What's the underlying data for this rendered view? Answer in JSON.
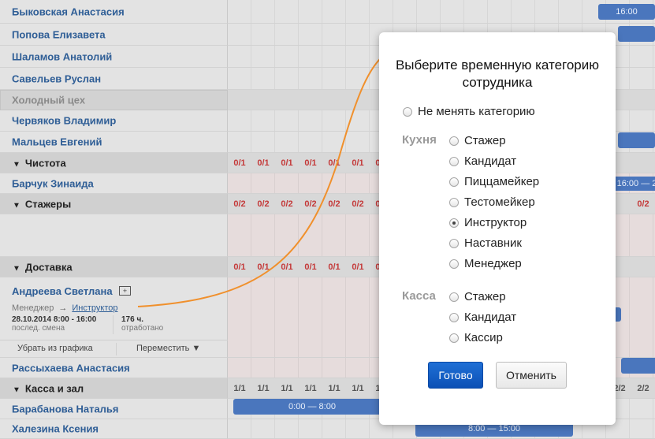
{
  "employees_top": [
    {
      "name": "Быковская Анастасия"
    },
    {
      "name": "Попова Елизавета"
    },
    {
      "name": "Шаламов Анатолий"
    },
    {
      "name": "Савельев Руслан"
    }
  ],
  "subsection": "Холодный цех",
  "employees_cold": [
    {
      "name": "Червяков Владимир"
    },
    {
      "name": "Мальцев Евгений"
    }
  ],
  "categories": {
    "cleaning": {
      "label": "Чистота",
      "counts": [
        "0/1",
        "0/1",
        "0/1",
        "0/1",
        "0/1",
        "0/1",
        "0/1"
      ]
    },
    "cleaning_employee": "Барчук Зинаида",
    "interns": {
      "label": "Стажеры",
      "counts": [
        "0/2",
        "0/2",
        "0/2",
        "0/2",
        "0/2",
        "0/2",
        "0/2"
      ],
      "right_count": "0/2"
    },
    "delivery": {
      "label": "Доставка",
      "counts": [
        "0/1",
        "0/1",
        "0/1",
        "0/1",
        "0/1",
        "0/1",
        "0/1"
      ]
    },
    "cash": {
      "label": "Касса и зал",
      "counts": [
        "1/1",
        "1/1",
        "1/1",
        "1/1",
        "1/1",
        "1/1",
        "1/1"
      ],
      "right_counts": [
        "2/2",
        "2/2"
      ]
    }
  },
  "expanded_employee": {
    "name": "Андреева Светлана",
    "plus_icon": "+",
    "from_category": "Менеджер",
    "arrow": "→",
    "to_category": "Инструктор",
    "last_shift_value": "28.10.2014 8:00 - 16:00",
    "last_shift_label": "послед. смена",
    "hours_value": "176 ч.",
    "hours_label": "отработано",
    "remove_action": "Убрать из графика",
    "move_action": "Переместить ▼"
  },
  "employees_bottom": [
    {
      "name": "Рассыхаева Анастасия"
    }
  ],
  "employees_cash": [
    {
      "name": "Барабанова Наталья"
    },
    {
      "name": "Халезина Ксения"
    }
  ],
  "shifts": {
    "top_right": "16:00",
    "barchuk_right": "16:00 — 2",
    "barabanova": "0:00 — 8:00",
    "khalezina": "8:00 — 15:00"
  },
  "modal": {
    "title": "Выберите временную категорию сотрудника",
    "no_change": "Не менять категорию",
    "kitchen_label": "Кухня",
    "kitchen_options": [
      "Стажер",
      "Кандидат",
      "Пиццамейкер",
      "Тестомейкер",
      "Инструктор",
      "Наставник",
      "Менеджер"
    ],
    "selected": "Инструктор",
    "cash_label": "Касса",
    "cash_options": [
      "Стажер",
      "Кандидат",
      "Кассир"
    ],
    "ok": "Готово",
    "cancel": "Отменить"
  },
  "colors": {
    "accent": "#2f5e96",
    "shift_bar": "#4a76bd",
    "count_red": "#c43a3a",
    "connector": "#f0902c",
    "ok_button": "#1466d0"
  }
}
